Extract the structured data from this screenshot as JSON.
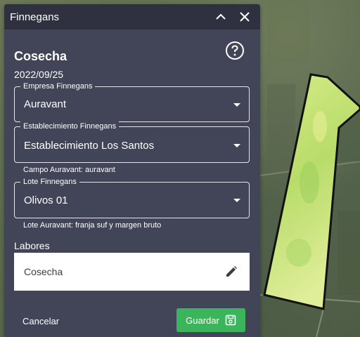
{
  "window": {
    "title": "Finnegans"
  },
  "form": {
    "heading": "Cosecha",
    "date": "2022/09/25",
    "empresa": {
      "legend": "Empresa Finnegans",
      "value": "Auravant"
    },
    "establecimiento": {
      "legend": "Establecimiento Finnegans",
      "value": "Establecimiento Los Santos"
    },
    "campo_helper": "Campo Auravant: auravant",
    "lote": {
      "legend": "Lote Finnegans",
      "value": "Olivos 01"
    },
    "lote_helper": "Lote Auravant: franja suf y margen bruto",
    "labores_label": "Labores",
    "labores": [
      {
        "name": "Cosecha"
      }
    ]
  },
  "actions": {
    "cancel_label": "Cancelar",
    "save_label": "Guardar"
  },
  "icons": {
    "collapse": "chevron-up-icon",
    "close": "close-icon",
    "help": "help-circle-icon",
    "edit": "pencil-icon",
    "save": "save-icon"
  },
  "colors": {
    "panel": "#424557",
    "titlebar": "#2f3140",
    "save_button": "#3bb55c",
    "field_polygon": "#c9e07a"
  }
}
